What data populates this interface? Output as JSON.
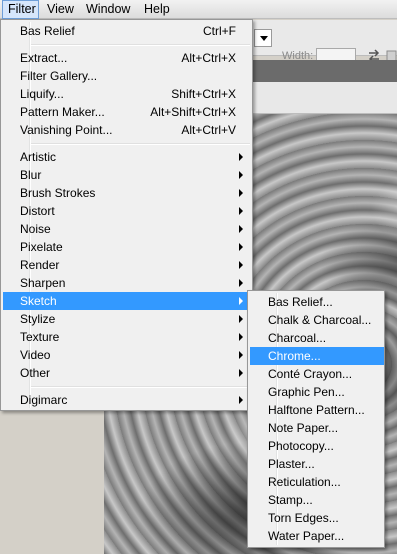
{
  "menubar": {
    "items": [
      "Filter",
      "View",
      "Window",
      "Help"
    ],
    "active": "Filter"
  },
  "options_bar": {
    "width_label": "Width:",
    "icons": [
      "dropdown-arrow-icon",
      "swap-arrows-icon"
    ]
  },
  "filter_menu": {
    "groups": [
      [
        {
          "label": "Bas Relief",
          "shortcut": "Ctrl+F"
        }
      ],
      [
        {
          "label": "Extract...",
          "shortcut": "Alt+Ctrl+X"
        },
        {
          "label": "Filter Gallery...",
          "shortcut": ""
        },
        {
          "label": "Liquify...",
          "shortcut": "Shift+Ctrl+X"
        },
        {
          "label": "Pattern Maker...",
          "shortcut": "Alt+Shift+Ctrl+X"
        },
        {
          "label": "Vanishing Point...",
          "shortcut": "Alt+Ctrl+V"
        }
      ],
      [
        {
          "label": "Artistic",
          "submenu": true
        },
        {
          "label": "Blur",
          "submenu": true
        },
        {
          "label": "Brush Strokes",
          "submenu": true
        },
        {
          "label": "Distort",
          "submenu": true
        },
        {
          "label": "Noise",
          "submenu": true
        },
        {
          "label": "Pixelate",
          "submenu": true
        },
        {
          "label": "Render",
          "submenu": true
        },
        {
          "label": "Sharpen",
          "submenu": true
        },
        {
          "label": "Sketch",
          "submenu": true,
          "highlighted": true
        },
        {
          "label": "Stylize",
          "submenu": true
        },
        {
          "label": "Texture",
          "submenu": true
        },
        {
          "label": "Video",
          "submenu": true
        },
        {
          "label": "Other",
          "submenu": true
        }
      ],
      [
        {
          "label": "Digimarc",
          "submenu": true
        }
      ]
    ]
  },
  "sketch_submenu": {
    "items": [
      "Bas Relief...",
      "Chalk & Charcoal...",
      "Charcoal...",
      "Chrome...",
      "Conté Crayon...",
      "Graphic Pen...",
      "Halftone Pattern...",
      "Note Paper...",
      "Photocopy...",
      "Plaster...",
      "Reticulation...",
      "Stamp...",
      "Torn Edges...",
      "Water Paper..."
    ],
    "highlighted": "Chrome..."
  },
  "colors": {
    "highlight": "#3399ff",
    "menu_bg": "#f0f0f0",
    "menubar_active": "#d6e6fb"
  }
}
